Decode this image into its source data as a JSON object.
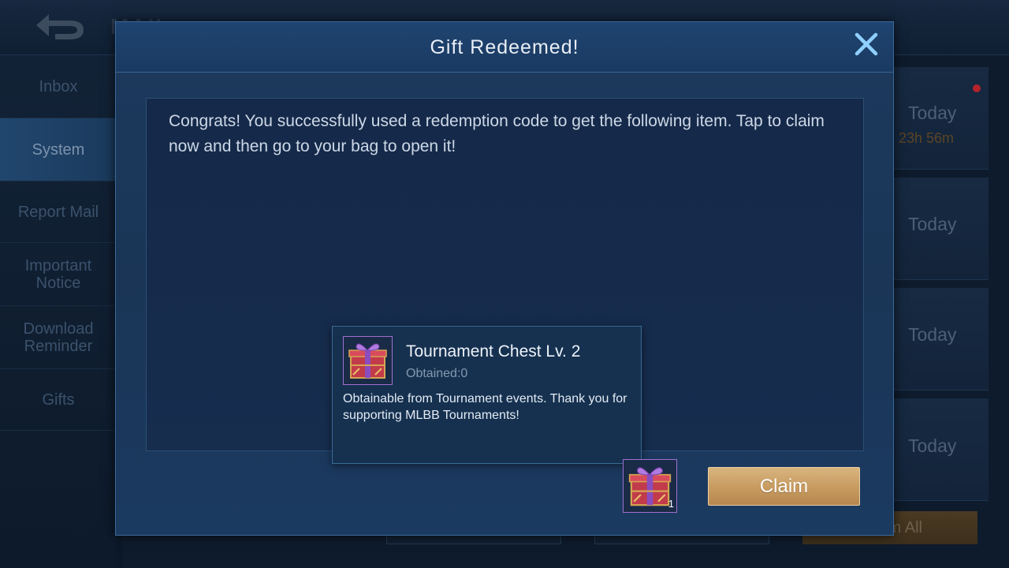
{
  "screen": {
    "title": "MAIL"
  },
  "side_nav": {
    "items": [
      {
        "label": "Inbox"
      },
      {
        "label": "System"
      },
      {
        "label": "Report Mail"
      },
      {
        "label": "Important Notice"
      },
      {
        "label": "Download Reminder"
      },
      {
        "label": "Gifts"
      }
    ],
    "active": "System"
  },
  "mail_list": {
    "rows": [
      {
        "date": "Today",
        "timer": "23h 56m"
      },
      {
        "date": "Today"
      },
      {
        "date": "Today"
      },
      {
        "date": "Today"
      }
    ],
    "claim_all_label": "m All"
  },
  "modal": {
    "title": "Gift Redeemed!",
    "message": "Congrats! You successfully used a redemption code to get the following item. Tap to claim now and then go to your bag to open it!",
    "item": {
      "name": "Tournament Chest Lv. 2",
      "obtained": "Obtained:0",
      "description": "Obtainable from Tournament events. Thank you for supporting MLBB Tournaments!",
      "icon": "gift-chest-icon"
    },
    "reward": {
      "icon": "gift-chest-icon",
      "count": "1"
    },
    "claim_label": "Claim",
    "close_icon": "close-icon"
  },
  "colors": {
    "accent_gold": "#c79b60",
    "frame_blue": "#3b6a9a",
    "item_border_purple": "#a06fd0",
    "notification_red": "#b4222c"
  }
}
